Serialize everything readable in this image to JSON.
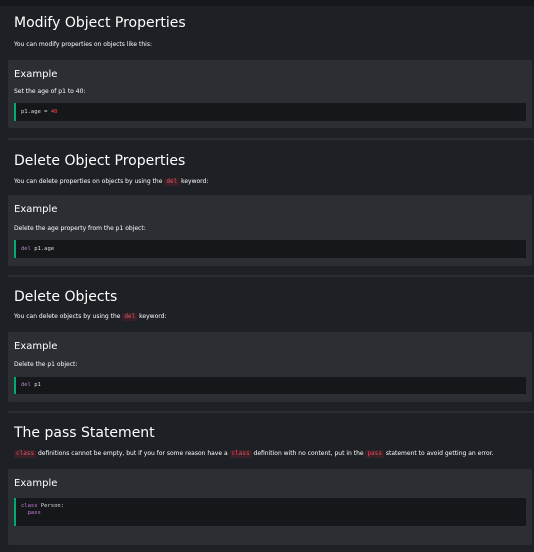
{
  "sections": {
    "modify": {
      "title": "Modify Object Properties",
      "desc": "You can modify properties on objects like this:",
      "example_title": "Example",
      "example_desc": "Set the age of p1 to 40:",
      "code": {
        "lhs": "p1.age = ",
        "num": "40"
      }
    },
    "delete_props": {
      "title": "Delete Object Properties",
      "desc_before": "You can delete properties on objects by using the ",
      "keyword": "del",
      "desc_after": " keyword:",
      "example_title": "Example",
      "example_desc": "Delete the age property from the p1 object:",
      "code": {
        "kw": "del",
        "rest": " p1.age"
      }
    },
    "delete_objects": {
      "title": "Delete Objects",
      "desc_before": "You can delete objects by using the ",
      "keyword": "del",
      "desc_after": " keyword:",
      "example_title": "Example",
      "example_desc": "Delete the p1 object:",
      "code": {
        "kw": "del",
        "rest": " p1"
      }
    },
    "pass": {
      "title": "The pass Statement",
      "kw_class_1": "class",
      "desc_1": " definitions cannot be empty, but if you for some reason have a ",
      "kw_class_2": "class",
      "desc_2": " definition with no content, put in the ",
      "kw_pass": "pass",
      "desc_3": " statement to avoid getting an error.",
      "example_title": "Example",
      "code": {
        "kw_class": "class",
        "line1_rest": " Person:",
        "kw_pass": "pass"
      }
    }
  },
  "colors": {
    "background": "#1d2024",
    "example_bg": "#2b2e33",
    "code_bg": "#15171a",
    "code_border": "#04aa6d",
    "keyword_red": "#e0506a",
    "code_keyword": "#c77ddb",
    "code_number": "#ff4d4d"
  }
}
